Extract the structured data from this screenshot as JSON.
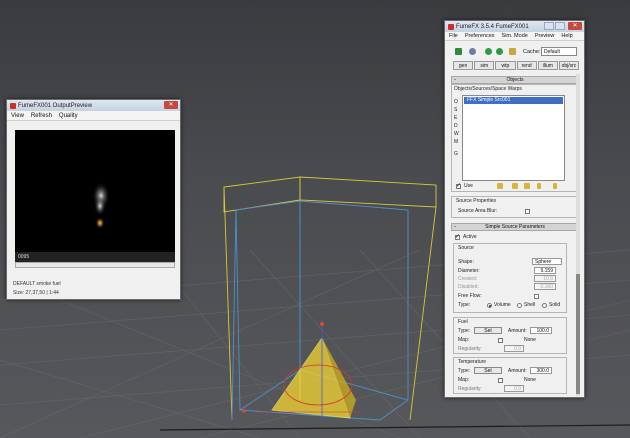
{
  "viewport": {
    "colors": {
      "grid": "#6b6c6f",
      "box_yellow": "#d6c93a",
      "box_blue": "#4f8fc8",
      "emitter": "#f5d533"
    }
  },
  "preview": {
    "title": "FumeFX001 OutputPreview",
    "menu": [
      "View",
      "Refresh",
      "Quality"
    ],
    "frame": "0095",
    "info_line1": "DEFAULT smoke fuel",
    "info_line2": "Size: 27,37,50 | 1:44"
  },
  "fumefx": {
    "title": "FumeFX 3.5.4 FumeFX001",
    "menu": [
      "File",
      "Preferences",
      "Sim. Mode",
      "Preview",
      "Help"
    ],
    "cache_label": "Cache:",
    "cache_value": "Default",
    "tabs": [
      "gen",
      "sim",
      "wtp",
      "rend",
      "illum",
      "obj/src"
    ],
    "objects": {
      "header": "Objects",
      "list_label": "Objects/Sources/Space Warps",
      "selected_item": "FFX Simple Src001",
      "side_letters": [
        "O",
        "S",
        "E",
        "D",
        "W",
        "M",
        "G"
      ],
      "use_label": "Use"
    },
    "source_props": {
      "label": "Source Properties",
      "blur_label": "Source Area Blur:"
    },
    "simple_source": {
      "header": "Simple Source Parameters",
      "active_label": "Active",
      "source_group": "Source",
      "shape_label": "Shape:",
      "shape_value": "Sphere",
      "diameter_label": "Diameter:",
      "diameter_value": "9.159",
      "created_label": "Created:",
      "created_value": "10.0",
      "disabled_label": "Disabled:",
      "disabled_value": "0.160",
      "freeflow_label": "Free Flow:",
      "type_label": "Type:",
      "type_options": [
        "Volume",
        "Shell",
        "Solid"
      ],
      "fuel_group": "Fuel",
      "fuel_type_label": "Type:",
      "fuel_set": "Set",
      "fuel_amount_label": "Amount:",
      "fuel_amount": "100.0",
      "fuel_map_label": "Map:",
      "fuel_map_value": "None",
      "fuel_reg_label": "Regularity:",
      "fuel_reg_value": "0.0",
      "temp_group": "Temperature",
      "temp_type_label": "Type:",
      "temp_set": "Set",
      "temp_amount_label": "Amount:",
      "temp_amount": "300.0",
      "temp_map_label": "Map:",
      "temp_map_value": "None",
      "temp_reg_label": "Regularity:",
      "temp_reg_value": "0.0"
    }
  }
}
